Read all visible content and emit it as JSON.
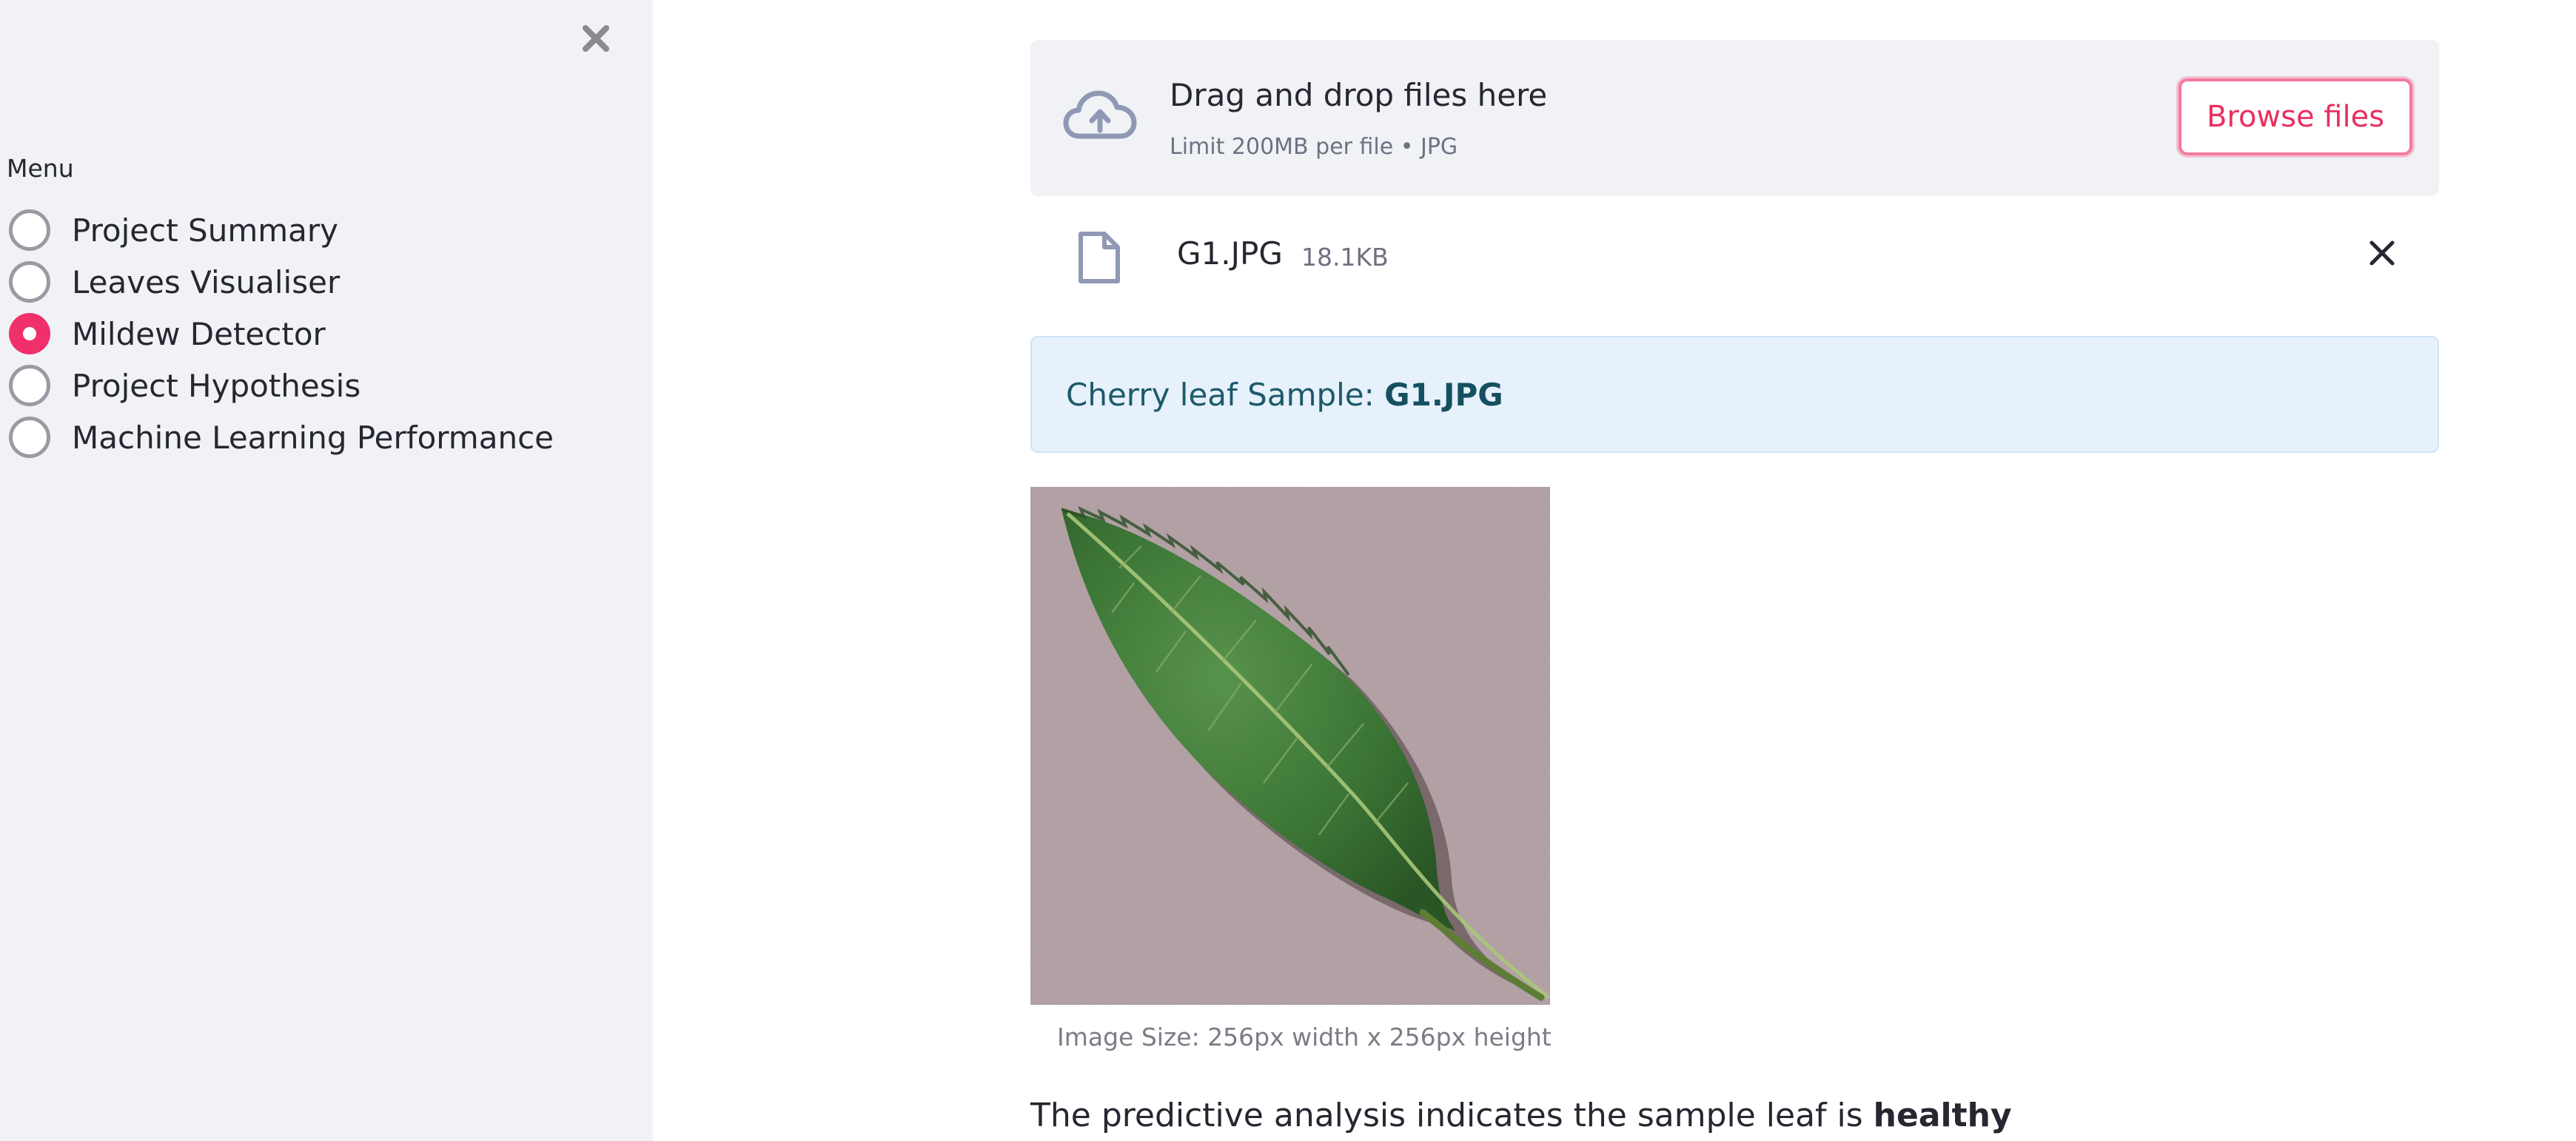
{
  "sidebar": {
    "close_icon": "close-x-icon",
    "menu_label": "Menu",
    "items": [
      {
        "label": "Project Summary",
        "selected": false
      },
      {
        "label": "Leaves Visualiser",
        "selected": false
      },
      {
        "label": "Mildew Detector",
        "selected": true
      },
      {
        "label": "Project Hypothesis",
        "selected": false
      },
      {
        "label": "Machine Learning Performance",
        "selected": false
      }
    ]
  },
  "uploader": {
    "icon": "cloud-upload-icon",
    "title": "Drag and drop files here",
    "subtitle": "Limit 200MB per file • JPG",
    "browse_label": "Browse files"
  },
  "file": {
    "icon": "file-icon",
    "name": "G1.JPG",
    "size": "18.1KB",
    "remove_icon": "close-icon"
  },
  "info": {
    "prefix": "Cherry leaf Sample: ",
    "filename": "G1.JPG"
  },
  "image": {
    "caption": "Image Size: 256px width x 256px height"
  },
  "result": {
    "prefix": "The predictive analysis indicates the sample leaf is ",
    "status": "healthy"
  },
  "colors": {
    "accent": "#f0306a",
    "sidebar_bg": "#f0f2f6",
    "info_bg": "#e6f1fb",
    "info_text": "#1c5a6a"
  }
}
